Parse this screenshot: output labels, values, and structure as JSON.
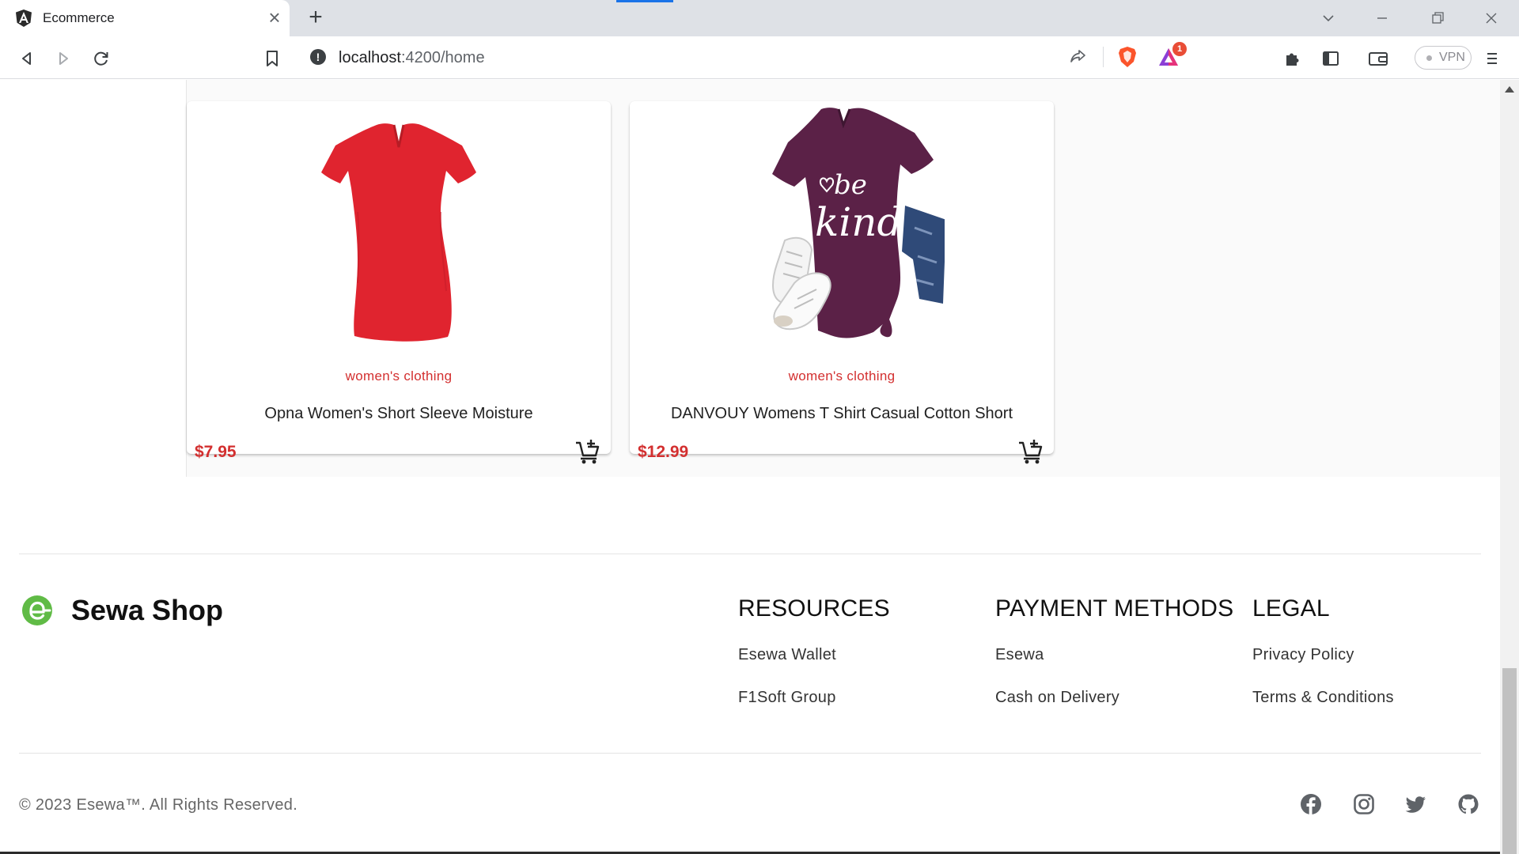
{
  "browser": {
    "tab_title": "Ecommerce",
    "url_host": "localhost",
    "url_path": ":4200/home",
    "vpn_label": "VPN",
    "rewards_badge": "1"
  },
  "products": [
    {
      "category": "women's clothing",
      "title": "Opna Women's Short Sleeve Moisture",
      "price": "$7.95",
      "image": "red-v-neck-tshirt",
      "color": "#e0242f"
    },
    {
      "category": "women's clothing",
      "title": "DANVOUY Womens T Shirt Casual Cotton Short",
      "price": "$12.99",
      "image": "purple-be-kind-tshirt-with-jeans-and-sneakers",
      "color": "#5b2147",
      "print_text_1": "be",
      "print_text_2": "kind"
    }
  ],
  "footer": {
    "brand_name": "Sewa Shop",
    "brand_logo_letter": "e",
    "brand_color": "#60bb46",
    "columns": [
      {
        "title": "RESOURCES",
        "links": [
          "Esewa Wallet",
          "F1Soft Group"
        ]
      },
      {
        "title": "PAYMENT METHODS",
        "links": [
          "Esewa",
          "Cash on Delivery"
        ]
      },
      {
        "title": "LEGAL",
        "links": [
          "Privacy Policy",
          "Terms & Conditions"
        ]
      }
    ],
    "copyright": "© 2023 Esewa™. All Rights Reserved.",
    "social_icons": [
      "facebook-icon",
      "instagram-icon",
      "twitter-icon",
      "github-icon"
    ]
  },
  "colors": {
    "accent_red": "#d32f2f",
    "chrome_bg": "#dee1e6"
  }
}
